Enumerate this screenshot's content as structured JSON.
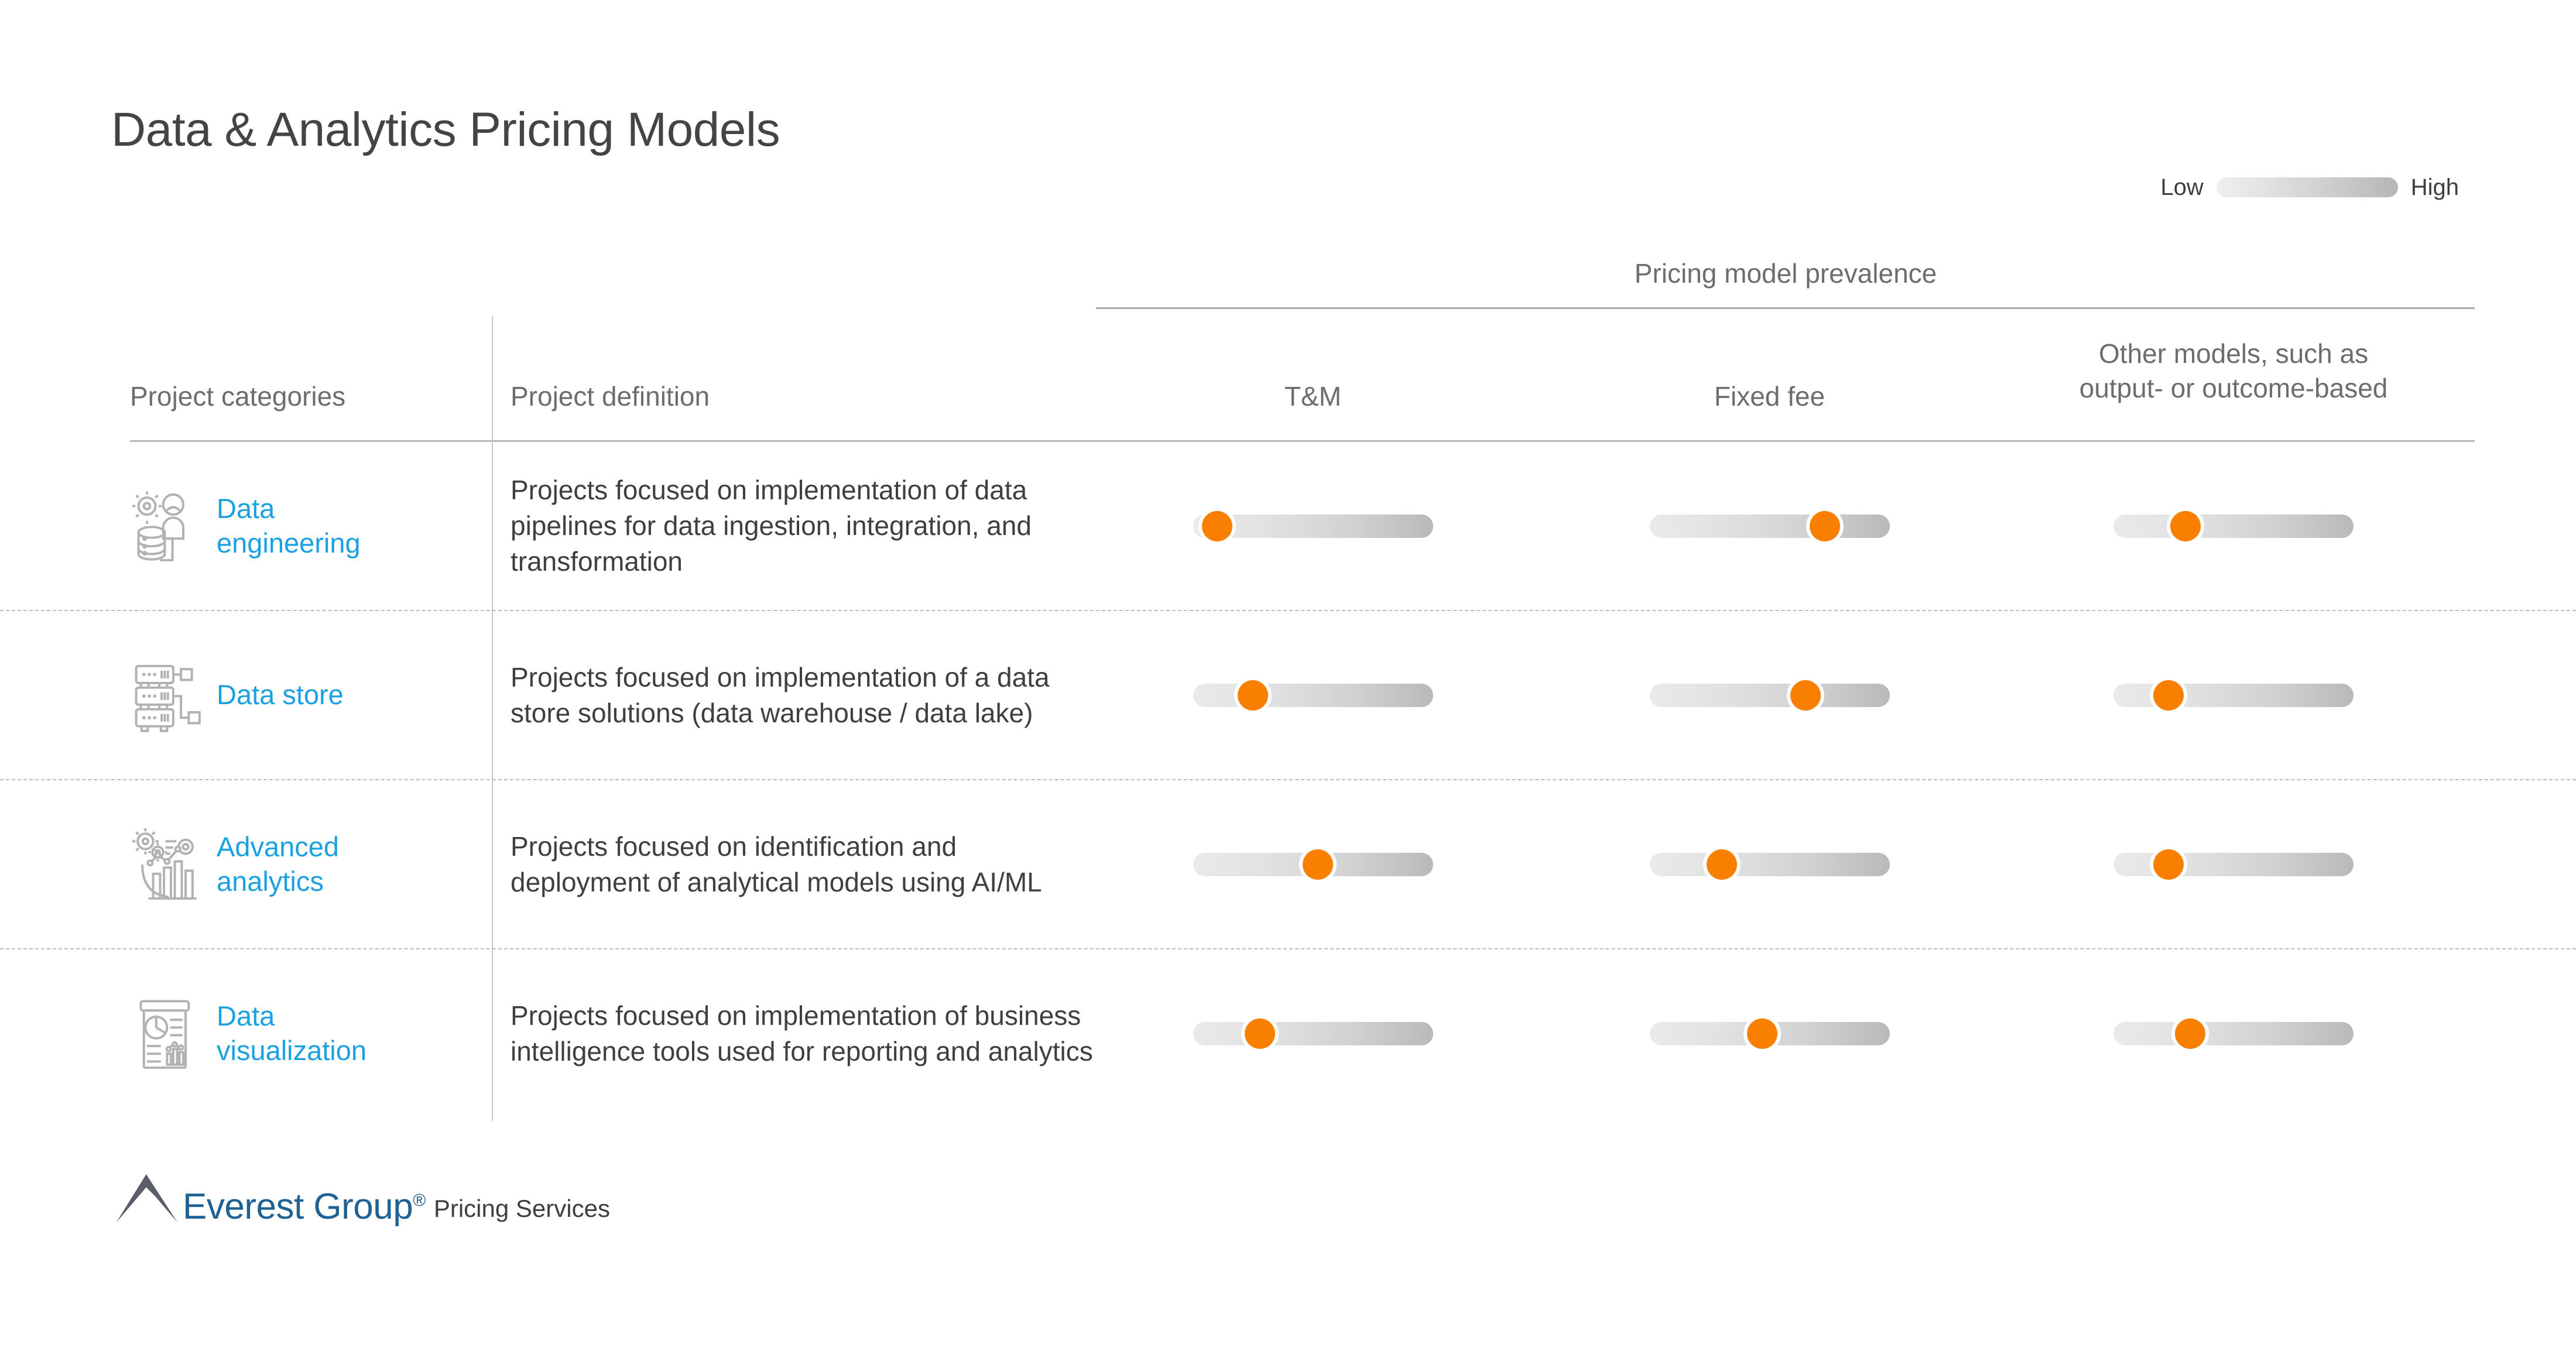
{
  "title": "Data & Analytics Pricing Models",
  "legend": {
    "low_label": "Low",
    "high_label": "High",
    "gradient_from": "#efefef",
    "gradient_to": "#b6b6b6"
  },
  "group_header": {
    "label": "Pricing model prevalence"
  },
  "columns": {
    "category": "Project categories",
    "definition": "Project definition",
    "tm": "T&M",
    "fixed_fee": "Fixed fee",
    "other_line1": "Other models, such as",
    "other_line2": "output- or outcome-based"
  },
  "accent_color": "#1BA1E2",
  "knob_color": "#F97F00",
  "rows": [
    {
      "icon": "data-engineering-icon",
      "category_line1": "Data",
      "category_line2": "engineering",
      "definition": "Projects focused on implementation of data pipelines for data ingestion, integration, and transformation",
      "tm": 10,
      "fixed_fee": 73,
      "other": 30
    },
    {
      "icon": "data-store-icon",
      "category_line1": "Data store",
      "category_line2": "",
      "definition": "Projects focused on implementation of a data store solutions (data warehouse / data lake)",
      "tm": 25,
      "fixed_fee": 65,
      "other": 23
    },
    {
      "icon": "advanced-analytics-icon",
      "category_line1": "Advanced",
      "category_line2": "analytics",
      "definition": "Projects focused on identification and deployment of analytical models using AI/ML",
      "tm": 52,
      "fixed_fee": 30,
      "other": 23
    },
    {
      "icon": "data-visualization-icon",
      "category_line1": "Data",
      "category_line2": "visualization",
      "definition": "Projects focused on implementation of business intelligence tools used for reporting and analytics",
      "tm": 28,
      "fixed_fee": 47,
      "other": 32
    }
  ],
  "footer": {
    "brand": "Everest Group",
    "registered": "®",
    "tagline": "Pricing Services"
  },
  "chart_data": {
    "type": "heatmap",
    "title": "Pricing model prevalence",
    "scale_label_low": "Low",
    "scale_label_high": "High",
    "categories": [
      "Data engineering",
      "Data store",
      "Advanced analytics",
      "Data visualization"
    ],
    "series": [
      {
        "name": "T&M",
        "values": [
          10,
          25,
          52,
          28
        ]
      },
      {
        "name": "Fixed fee",
        "values": [
          73,
          65,
          30,
          47
        ]
      },
      {
        "name": "Other models, such as output- or outcome-based",
        "values": [
          30,
          23,
          23,
          32
        ]
      }
    ],
    "xlabel": "Pricing model prevalence",
    "ylabel": "Project categories",
    "xlim": [
      0,
      100
    ],
    "grid": false,
    "legend_position": "top-right"
  }
}
